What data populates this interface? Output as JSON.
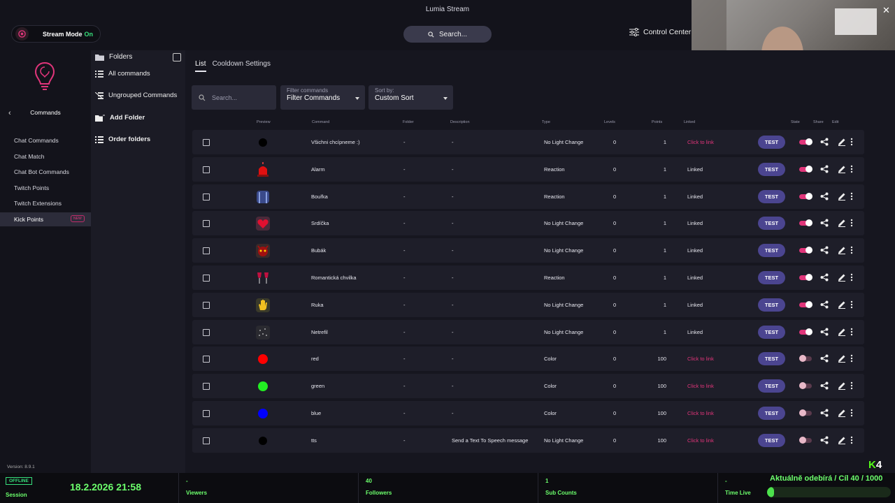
{
  "app": {
    "title": "Lumia Stream"
  },
  "stream_mode": {
    "label": "Stream Mode",
    "state": "On"
  },
  "top_search": {
    "label": "Search..."
  },
  "control_center": {
    "label": "Control Center"
  },
  "nav": {
    "title": "Commands",
    "items": [
      {
        "label": "Chat Commands"
      },
      {
        "label": "Chat Match"
      },
      {
        "label": "Chat Bot Commands"
      },
      {
        "label": "Twitch Points"
      },
      {
        "label": "Twitch Extensions"
      },
      {
        "label": "Kick Points",
        "badge": "NEW"
      }
    ],
    "version": "Version: 8.9.1"
  },
  "folders": {
    "title": "Folders",
    "all": "All commands",
    "ungrouped": "Ungrouped Commands",
    "add": "Add Folder",
    "order": "Order folders"
  },
  "tabs": [
    "List",
    "Cooldown Settings"
  ],
  "toolbar": {
    "search_placeholder": "Search...",
    "filter_caption": "Filter commands",
    "filter_value": "Filter Commands",
    "sort_caption": "Sort by:",
    "sort_value": "Custom Sort"
  },
  "columns": {
    "preview": "Preview",
    "command": "Command",
    "folder": "Folder",
    "description": "Description",
    "type": "Type",
    "levels": "Levels",
    "points": "Points",
    "linked": "Linked",
    "state": "State",
    "share": "Share",
    "edit": "Edit"
  },
  "colors": {
    "accent": "#e0357a",
    "test_button": "#4b4590",
    "green": "#6cff6c"
  },
  "rows": [
    {
      "preview": "black-dot",
      "command": "Všichni chcípneme :)",
      "folder": "-",
      "description": "-",
      "type": "No Light Change",
      "levels": "0",
      "points": "1",
      "linked": "Click to link",
      "state_on": true
    },
    {
      "preview": "siren-icon",
      "command": "Alarm",
      "folder": "-",
      "description": "-",
      "type": "Reaction",
      "levels": "0",
      "points": "1",
      "linked": "Linked",
      "state_on": true
    },
    {
      "preview": "storm-icon",
      "command": "Bouřka",
      "folder": "-",
      "description": "-",
      "type": "Reaction",
      "levels": "0",
      "points": "1",
      "linked": "Linked",
      "state_on": true
    },
    {
      "preview": "heart-icon",
      "command": "Srdíčka",
      "folder": "-",
      "description": "-",
      "type": "No Light Change",
      "levels": "0",
      "points": "1",
      "linked": "Linked",
      "state_on": true
    },
    {
      "preview": "demon-icon",
      "command": "Bubák",
      "folder": "-",
      "description": "-",
      "type": "No Light Change",
      "levels": "0",
      "points": "1",
      "linked": "Linked",
      "state_on": true
    },
    {
      "preview": "wine-glasses-icon",
      "command": "Romantická chvilka",
      "folder": "-",
      "description": "-",
      "type": "Reaction",
      "levels": "0",
      "points": "1",
      "linked": "Linked",
      "state_on": true
    },
    {
      "preview": "hand-icon",
      "command": "Ruka",
      "folder": "-",
      "description": "-",
      "type": "No Light Change",
      "levels": "0",
      "points": "1",
      "linked": "Linked",
      "state_on": true
    },
    {
      "preview": "sparkle-icon",
      "command": "Netrefil",
      "folder": "-",
      "description": "-",
      "type": "No Light Change",
      "levels": "0",
      "points": "1",
      "linked": "Linked",
      "state_on": true
    },
    {
      "preview": "red-dot",
      "command": "red",
      "folder": "-",
      "description": "-",
      "type": "Color",
      "levels": "0",
      "points": "100",
      "linked": "Click to link",
      "state_on": false
    },
    {
      "preview": "green-dot",
      "command": "green",
      "folder": "-",
      "description": "-",
      "type": "Color",
      "levels": "0",
      "points": "100",
      "linked": "Click to link",
      "state_on": false
    },
    {
      "preview": "blue-dot",
      "command": "blue",
      "folder": "-",
      "description": "-",
      "type": "Color",
      "levels": "0",
      "points": "100",
      "linked": "Click to link",
      "state_on": false
    },
    {
      "preview": "black-dot",
      "command": "tts",
      "folder": "-",
      "description": "Send a Text To Speech message",
      "type": "No Light Change",
      "levels": "0",
      "points": "100",
      "linked": "Click to link",
      "state_on": false
    }
  ],
  "test_label": "TEST",
  "status": {
    "offline": "OFFLINE",
    "session": "Session",
    "datetime": "18.2.2026 21:58",
    "viewers_value": "-",
    "viewers": "Viewers",
    "followers_value": "40",
    "followers": "Followers",
    "subs_value": "1",
    "subs": "Sub Counts",
    "timelive_value": "-",
    "timelive": "Time Live",
    "sub_goal": "Aktuálně odebírá / Cíl  40 / 1000",
    "sub_goal_fraction": 0.04,
    "overlay_logo": "K4"
  }
}
